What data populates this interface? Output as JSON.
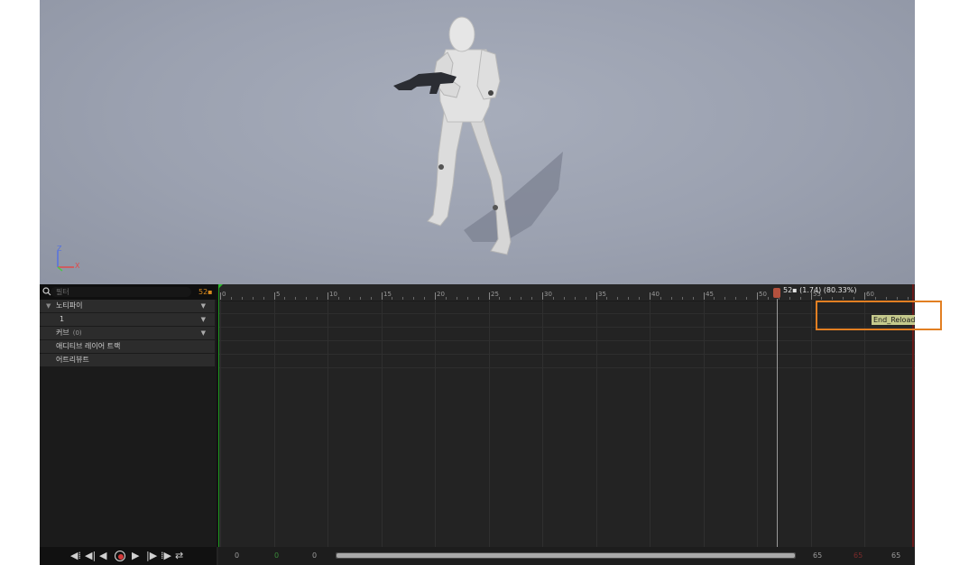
{
  "viewport": {
    "axis_labels": {
      "z": "Z",
      "x": "X"
    }
  },
  "track_panel": {
    "filter": {
      "placeholder": "필터",
      "count": "52▪"
    },
    "rows": [
      {
        "label": "노티파이",
        "collapsible": true
      },
      {
        "label": "1",
        "collapsible": false
      },
      {
        "label": "커브",
        "count": "(0)",
        "collapsible": false
      },
      {
        "label": "애디티브 레이어 트랙",
        "collapsible": false
      },
      {
        "label": "어트리뷰트",
        "collapsible": false
      }
    ]
  },
  "timeline": {
    "ruler_labels": [
      "0",
      "5",
      "10",
      "15",
      "20",
      "25",
      "30",
      "35",
      "40",
      "45",
      "50",
      "55",
      "60"
    ],
    "playhead": {
      "frame": 52,
      "label": "52▪ (1.74) (80.33%)"
    },
    "notify": {
      "label": "End_Reload"
    }
  },
  "transport": {
    "buttons": [
      "to-start",
      "step-back",
      "play-reverse",
      "record",
      "play",
      "step-forward",
      "to-end",
      "loop"
    ]
  },
  "bottom_bar": {
    "left_values": [
      "0",
      "0",
      "0"
    ],
    "right_values": [
      "65",
      "65",
      "65"
    ]
  },
  "colors": {
    "playhead": "#b4513e",
    "notify_fill": "#c5c98c",
    "highlight": "#e27f22",
    "start_marker": "#2ab52a",
    "filter_count": "#d88a1e"
  }
}
